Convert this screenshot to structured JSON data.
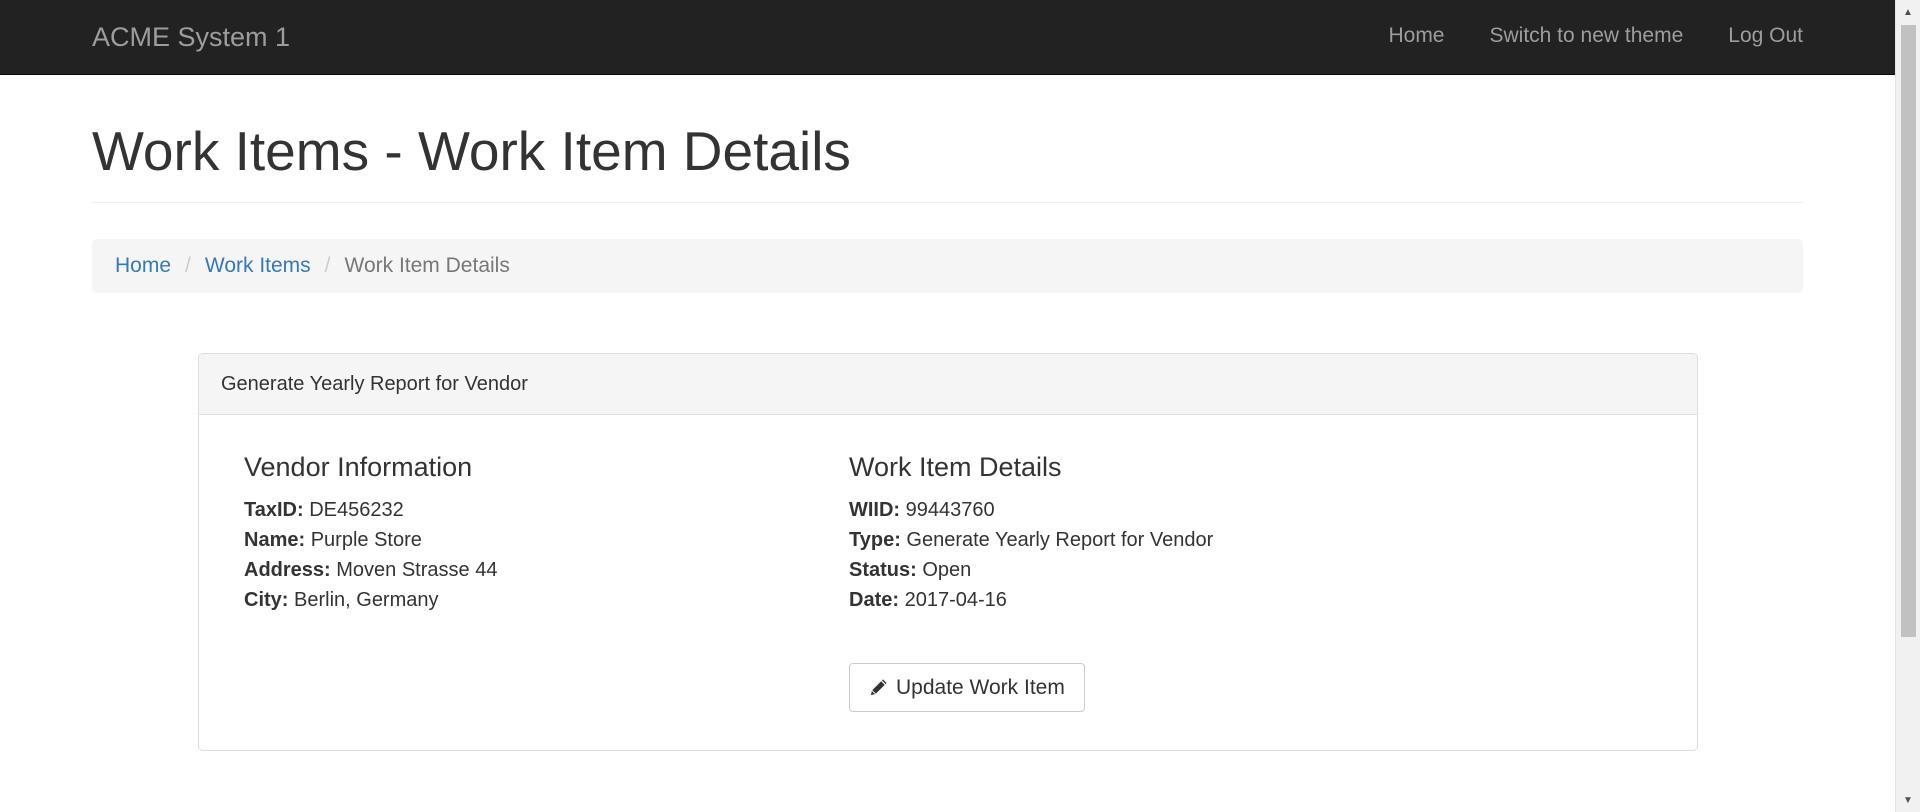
{
  "navbar": {
    "brand": "ACME System 1",
    "links": [
      "Home",
      "Switch to new theme",
      "Log Out"
    ]
  },
  "page": {
    "title": "Work Items - Work Item Details"
  },
  "breadcrumb": {
    "items": [
      "Home",
      "Work Items"
    ],
    "active": "Work Item Details",
    "separator": "/"
  },
  "panel": {
    "heading": "Generate Yearly Report for Vendor",
    "vendor": {
      "title": "Vendor Information",
      "fields": [
        {
          "label": "TaxID:",
          "value": " DE456232"
        },
        {
          "label": "Name:",
          "value": " Purple Store"
        },
        {
          "label": "Address:",
          "value": " Moven Strasse 44"
        },
        {
          "label": "City:",
          "value": " Berlin, Germany"
        }
      ]
    },
    "work_item": {
      "title": "Work Item Details",
      "fields": [
        {
          "label": "WIID:",
          "value": " 99443760"
        },
        {
          "label": "Type:",
          "value": " Generate Yearly Report for Vendor"
        },
        {
          "label": "Status:",
          "value": " Open"
        },
        {
          "label": "Date:",
          "value": " 2017-04-16"
        }
      ]
    },
    "update_button": {
      "label": "Update Work Item",
      "icon": "pencil-icon"
    }
  },
  "colors": {
    "navbar_bg": "#222222",
    "navbar_text": "#9d9d9d",
    "link": "#337ab7",
    "breadcrumb_bg": "#f5f5f5"
  }
}
